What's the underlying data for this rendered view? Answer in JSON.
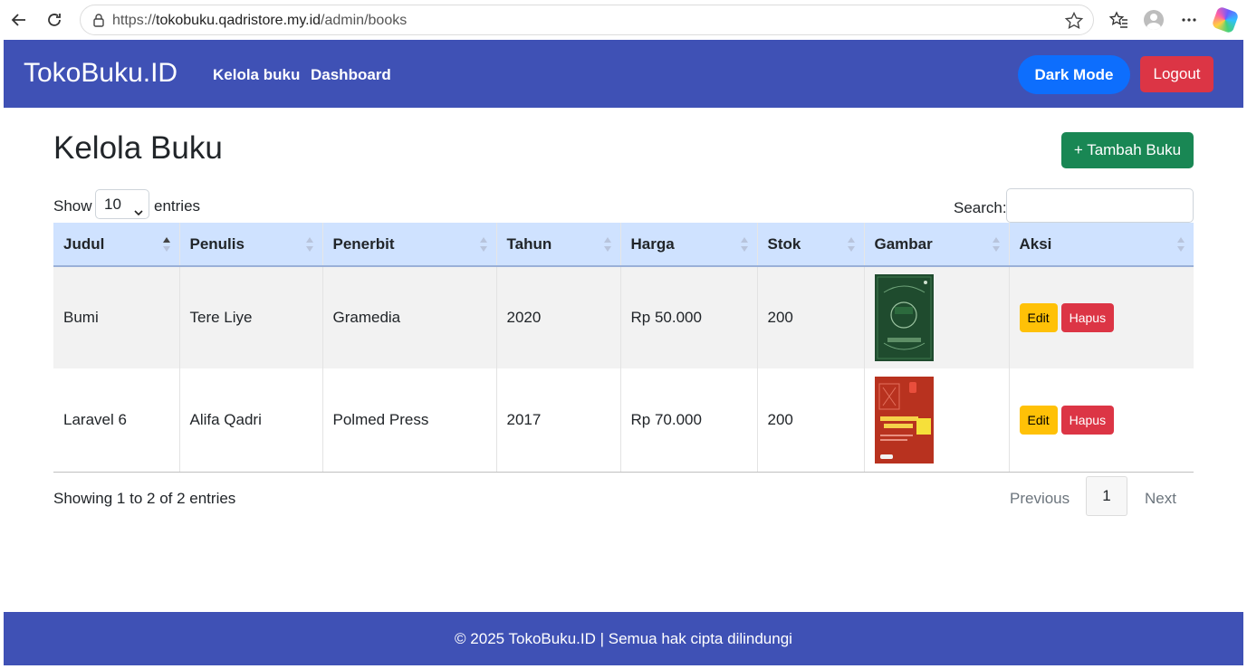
{
  "browser": {
    "url_prefix": "https://",
    "url_host": "tokobuku.qadristore.my.id",
    "url_path": "/admin/books"
  },
  "navbar": {
    "brand": "TokoBuku.ID",
    "links": [
      "Kelola buku",
      "Dashboard"
    ],
    "dark_mode_label": "Dark Mode",
    "logout_label": "Logout"
  },
  "main": {
    "title": "Kelola Buku",
    "add_button": "+ Tambah Buku",
    "show_label": "Show",
    "entries_value": "10",
    "entries_label": "entries",
    "search_label": "Search:",
    "search_value": ""
  },
  "table": {
    "headers": [
      "Judul",
      "Penulis",
      "Penerbit",
      "Tahun",
      "Harga",
      "Stok",
      "Gambar",
      "Aksi"
    ],
    "rows": [
      [
        "Bumi",
        "Tere Liye",
        "Gramedia",
        "2020",
        "Rp 50.000",
        "200"
      ],
      [
        "Laravel 6",
        "Alifa Qadri",
        "Polmed Press",
        "2017",
        "Rp 70.000",
        "200"
      ]
    ],
    "edit_label": "Edit",
    "delete_label": "Hapus"
  },
  "pagination": {
    "info": "Showing 1 to 2 of 2 entries",
    "previous": "Previous",
    "current_page": "1",
    "next": "Next"
  },
  "footer": {
    "text": "© 2025 TokoBuku.ID | Semua hak cipta dilindungi"
  },
  "colors": {
    "navbar": "#3f51b5",
    "dark_mode_button": "#0d6efd",
    "logout_button": "#dc3545",
    "add_button": "#198754",
    "edit_button": "#ffc107",
    "header_row": "#cfe2ff"
  }
}
